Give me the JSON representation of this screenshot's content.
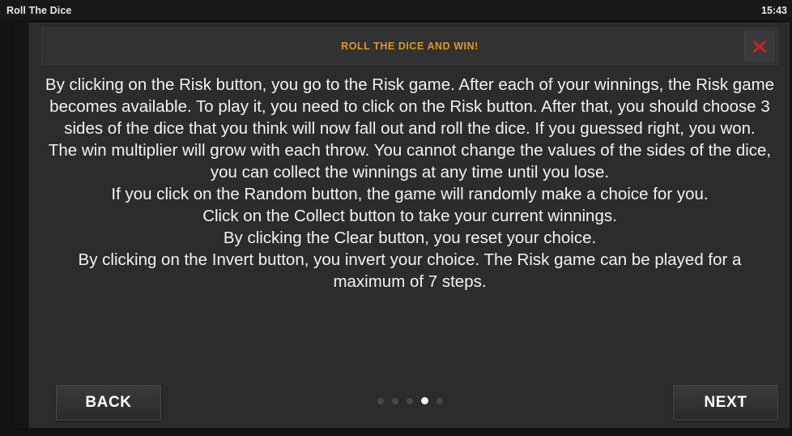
{
  "titlebar": {
    "app_title": "Roll The Dice",
    "clock": "15:43"
  },
  "banner": {
    "title": "ROLL THE DICE AND WIN!",
    "title_color": "#d9982a",
    "close_icon": "close-x-icon",
    "close_color": "#cc2222"
  },
  "help": {
    "paragraphs": [
      "By clicking on the Risk button, you go to the Risk game. After each of your winnings, the Risk game becomes available. To play it, you need to click on the Risk button. After that, you should choose 3 sides of the dice that you think will now fall out and roll the dice. If you guessed right, you won.",
      "The win multiplier will grow with each throw. You cannot change the values of the sides of the dice, you can collect the winnings at any time until you lose.",
      "If you click on the Random button, the game will randomly make a choice for you.",
      "Click on the Collect button to take your current winnings.",
      "By clicking the Clear button, you reset your choice.",
      "By clicking on the Invert button, you invert your choice. The Risk game can be played for a maximum of 7 steps."
    ]
  },
  "footer": {
    "back_label": "BACK",
    "next_label": "NEXT",
    "pagination": {
      "total": 5,
      "active_index": 4
    }
  }
}
